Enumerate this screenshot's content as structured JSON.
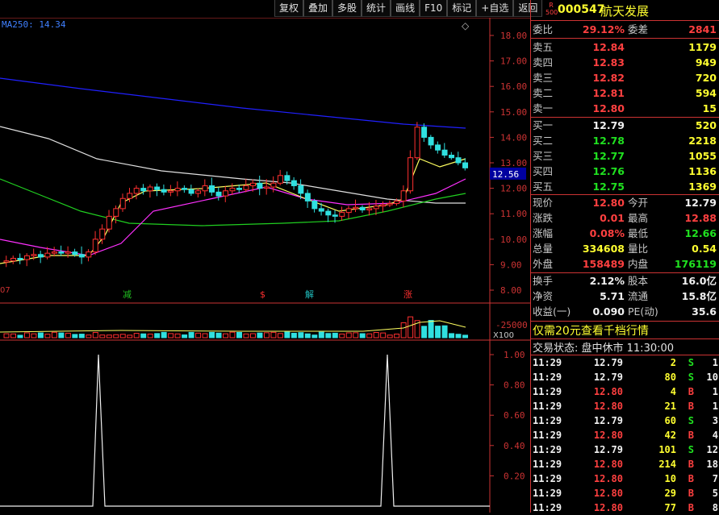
{
  "toolbar": [
    "复权",
    "叠加",
    "多股",
    "统计",
    "画线",
    "F10",
    "标记",
    "+自选",
    "返回"
  ],
  "chart": {
    "ma_label": "MA250: 14.34",
    "date_left": "07",
    "price_ticks": [
      "18.00",
      "17.00",
      "16.00",
      "15.00",
      "14.00",
      "13.00",
      "12.00",
      "11.00",
      "10.00",
      "9.00",
      "8.00"
    ],
    "current_price_tag": "12.56",
    "markers": [
      {
        "text": "减",
        "color": "#20c020"
      },
      {
        "text": "$",
        "color": "#ff3030"
      },
      {
        "text": "解",
        "color": "#20c0c0"
      },
      {
        "text": "涨",
        "color": "#ff3030"
      }
    ],
    "volume_ticks": [
      "25000",
      "X100"
    ],
    "indicator_ticks": [
      "1.00",
      "0.80",
      "0.60",
      "0.40",
      "0.20"
    ]
  },
  "stock": {
    "badge_top": "R",
    "badge_bottom": "500",
    "code": "000547",
    "name": "航天发展"
  },
  "weibi": {
    "label": "委比",
    "value": "29.12%",
    "label2": "委差",
    "value2": "2841"
  },
  "asks": [
    {
      "label": "卖五",
      "price": "12.84",
      "vol": "1179"
    },
    {
      "label": "卖四",
      "price": "12.83",
      "vol": "949"
    },
    {
      "label": "卖三",
      "price": "12.82",
      "vol": "720"
    },
    {
      "label": "卖二",
      "price": "12.81",
      "vol": "594"
    },
    {
      "label": "卖一",
      "price": "12.80",
      "vol": "15"
    }
  ],
  "bids": [
    {
      "label": "买一",
      "price": "12.79",
      "vol": "520"
    },
    {
      "label": "买二",
      "price": "12.78",
      "vol": "2218"
    },
    {
      "label": "买三",
      "price": "12.77",
      "vol": "1055"
    },
    {
      "label": "买四",
      "price": "12.76",
      "vol": "1136"
    },
    {
      "label": "买五",
      "price": "12.75",
      "vol": "1369"
    }
  ],
  "quote": [
    {
      "l1": "现价",
      "v1": "12.80",
      "c1": "red",
      "l2": "今开",
      "v2": "12.79",
      "c2": "white"
    },
    {
      "l1": "涨跌",
      "v1": "0.01",
      "c1": "red",
      "l2": "最高",
      "v2": "12.88",
      "c2": "red"
    },
    {
      "l1": "涨幅",
      "v1": "0.08%",
      "c1": "red",
      "l2": "最低",
      "v2": "12.66",
      "c2": "green"
    },
    {
      "l1": "总量",
      "v1": "334608",
      "c1": "yellow",
      "l2": "量比",
      "v2": "0.54",
      "c2": "yellow"
    },
    {
      "l1": "外盘",
      "v1": "158489",
      "c1": "red",
      "l2": "内盘",
      "v2": "176119",
      "c2": "green"
    }
  ],
  "fund": [
    {
      "l1": "换手",
      "v1": "2.12%",
      "l2": "股本",
      "v2": "16.0亿"
    },
    {
      "l1": "净资",
      "v1": "5.71",
      "l2": "流通",
      "v2": "15.8亿"
    },
    {
      "l1": "收益(一)",
      "v1": "0.090",
      "l2": "PE(动)",
      "v2": "35.6"
    }
  ],
  "promo": "仅需20元查看千档行情",
  "status": "交易状态: 盘中休市 11:30:00",
  "ticks": [
    {
      "t": "11:29",
      "p": "12.79",
      "pc": "white",
      "v": "2",
      "s": "S",
      "n": "1"
    },
    {
      "t": "11:29",
      "p": "12.79",
      "pc": "white",
      "v": "80",
      "s": "S",
      "n": "10"
    },
    {
      "t": "11:29",
      "p": "12.80",
      "pc": "red",
      "v": "4",
      "s": "B",
      "n": "1"
    },
    {
      "t": "11:29",
      "p": "12.80",
      "pc": "red",
      "v": "21",
      "s": "B",
      "n": "1"
    },
    {
      "t": "11:29",
      "p": "12.79",
      "pc": "white",
      "v": "60",
      "s": "S",
      "n": "3"
    },
    {
      "t": "11:29",
      "p": "12.80",
      "pc": "red",
      "v": "42",
      "s": "B",
      "n": "4"
    },
    {
      "t": "11:29",
      "p": "12.79",
      "pc": "white",
      "v": "101",
      "s": "S",
      "n": "12"
    },
    {
      "t": "11:29",
      "p": "12.80",
      "pc": "red",
      "v": "214",
      "s": "B",
      "n": "18"
    },
    {
      "t": "11:29",
      "p": "12.80",
      "pc": "red",
      "v": "10",
      "s": "B",
      "n": "7"
    },
    {
      "t": "11:29",
      "p": "12.80",
      "pc": "red",
      "v": "29",
      "s": "B",
      "n": "5"
    },
    {
      "t": "11:29",
      "p": "12.80",
      "pc": "red",
      "v": "77",
      "s": "B",
      "n": "8"
    }
  ],
  "colors": {
    "up": "#ff3030",
    "down": "#30e0e0",
    "ma_blue": "#2020ff",
    "ma_white": "#e0e0e0",
    "ma_yellow": "#ffff60",
    "ma_magenta": "#ff30ff",
    "ma_green": "#20d020"
  }
}
